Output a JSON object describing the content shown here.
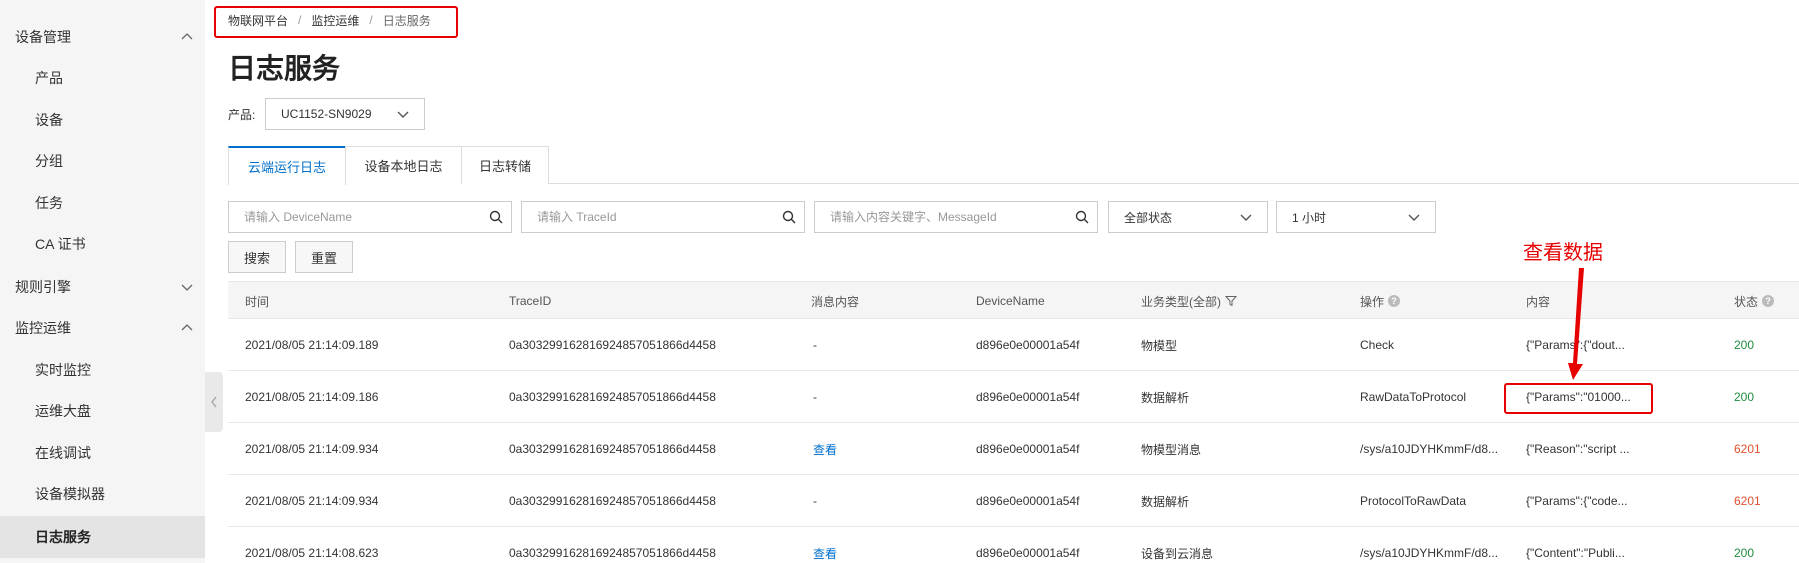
{
  "sidebar": {
    "groups": [
      {
        "label": "设备管理",
        "items": [
          "产品",
          "设备",
          "分组",
          "任务",
          "CA 证书"
        ]
      },
      {
        "label": "规则引擎"
      },
      {
        "label": "监控运维",
        "items": [
          "实时监控",
          "运维大盘",
          "在线调试",
          "设备模拟器",
          "日志服务"
        ]
      }
    ]
  },
  "breadcrumb": [
    "物联网平台",
    "监控运维",
    "日志服务"
  ],
  "page_title": "日志服务",
  "product": {
    "label": "产品:",
    "value": "UC1152-SN9029"
  },
  "tabs": [
    "云端运行日志",
    "设备本地日志",
    "日志转储"
  ],
  "filters": {
    "device_placeholder": "请输入 DeviceName",
    "trace_placeholder": "请输入 TraceId",
    "keyword_placeholder": "请输入内容关键字、MessageId",
    "status_value": "全部状态",
    "time_value": "1 小时",
    "search_label": "搜索",
    "reset_label": "重置"
  },
  "table": {
    "headers": [
      "时间",
      "TraceID",
      "消息内容",
      "DeviceName",
      "业务类型(全部)",
      "操作",
      "内容",
      "状态"
    ],
    "rows": [
      {
        "time": "2021/08/05 21:14:09.189",
        "trace": "0a303299162816924857051866d4458",
        "msg": "-",
        "device": "d896e0e00001a54f",
        "type": "物模型",
        "op": "Check",
        "content": "{\"Params\":{\"dout...",
        "status": "200"
      },
      {
        "time": "2021/08/05 21:14:09.186",
        "trace": "0a303299162816924857051866d4458",
        "msg": "-",
        "device": "d896e0e00001a54f",
        "type": "数据解析",
        "op": "RawDataToProtocol",
        "content": "{\"Params\":\"01000...",
        "status": "200"
      },
      {
        "time": "2021/08/05 21:14:09.934",
        "trace": "0a303299162816924857051866d4458",
        "msg": "查看",
        "device": "d896e0e00001a54f",
        "type": "物模型消息",
        "op": "/sys/a10JDYHKmmF/d8...",
        "content": "{\"Reason\":\"script ...",
        "status": "6201"
      },
      {
        "time": "2021/08/05 21:14:09.934",
        "trace": "0a303299162816924857051866d4458",
        "msg": "-",
        "device": "d896e0e00001a54f",
        "type": "数据解析",
        "op": "ProtocolToRawData",
        "content": "{\"Params\":{\"code...",
        "status": "6201"
      },
      {
        "time": "2021/08/05 21:14:08.623",
        "trace": "0a303299162816924857051866d4458",
        "msg": "查看",
        "device": "d896e0e00001a54f",
        "type": "设备到云消息",
        "op": "/sys/a10JDYHKmmF/d8...",
        "content": "{\"Content\":\"Publi...",
        "status": "200"
      }
    ]
  },
  "annotation": {
    "label": "查看数据"
  },
  "colors": {
    "accent": "#0070cc",
    "annotation": "#e60000",
    "ok": "#1e8e3e",
    "error": "#e0522e"
  }
}
